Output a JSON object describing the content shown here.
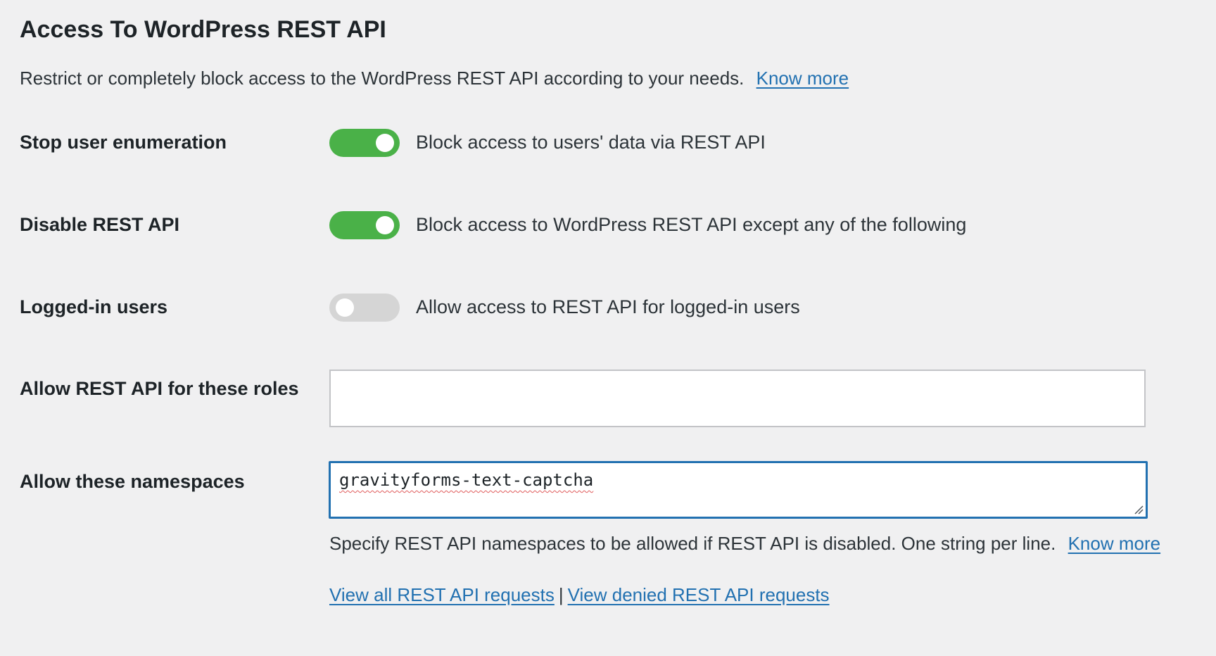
{
  "section": {
    "title": "Access To WordPress REST API",
    "description": "Restrict or completely block access to the WordPress REST API according to your needs.",
    "know_more": "Know more"
  },
  "settings": [
    {
      "label": "Stop user enumeration",
      "enabled": true,
      "description": "Block access to users' data via REST API"
    },
    {
      "label": "Disable REST API",
      "enabled": true,
      "description": "Block access to WordPress REST API except any of the following"
    },
    {
      "label": "Logged-in users",
      "enabled": false,
      "description": "Allow access to REST API for logged-in users"
    }
  ],
  "roles": {
    "label": "Allow REST API for these roles",
    "value": ""
  },
  "namespaces": {
    "label": "Allow these namespaces",
    "value": "gravityforms-text-captcha",
    "help": "Specify REST API namespaces to be allowed if REST API is disabled. One string per line.",
    "know_more": "Know more"
  },
  "links": {
    "view_all": "View all REST API requests",
    "separator": "|",
    "view_denied": "View denied REST API requests"
  },
  "colors": {
    "toggle_on": "#4ab148",
    "toggle_off": "#d5d5d5",
    "link": "#2271b1",
    "focus_border": "#2271b1"
  }
}
